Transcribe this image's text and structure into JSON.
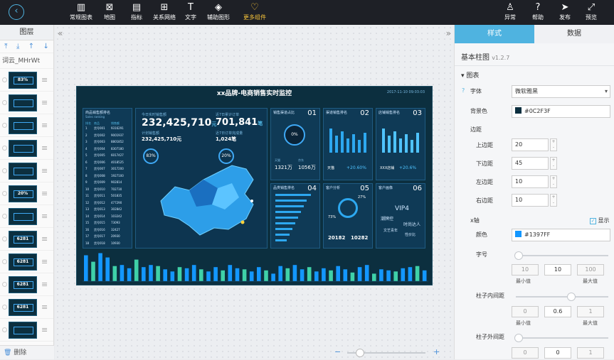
{
  "toolbar": {
    "tools": [
      {
        "label": "常规图表",
        "icon": "chart-icon"
      },
      {
        "label": "地图",
        "icon": "map-icon"
      },
      {
        "label": "指标",
        "icon": "indicator-icon"
      },
      {
        "label": "关系网络",
        "icon": "network-icon"
      },
      {
        "label": "文字",
        "icon": "text-icon"
      },
      {
        "label": "辅助图形",
        "icon": "shape-icon"
      },
      {
        "label": "更多组件",
        "icon": "more-icon"
      }
    ],
    "right": [
      {
        "label": "异常",
        "icon": "alert-icon"
      },
      {
        "label": "帮助",
        "icon": "help-icon"
      },
      {
        "label": "发布",
        "icon": "publish-icon"
      },
      {
        "label": "预览",
        "icon": "preview-icon"
      }
    ]
  },
  "layers": {
    "title": "图层",
    "word_cloud_item": "词云_MHrWt",
    "delete_label": "删除",
    "thumbs": [
      {
        "t": "83%"
      },
      {
        "t": ""
      },
      {
        "t": ""
      },
      {
        "t": ""
      },
      {
        "t": ""
      },
      {
        "t": "20%"
      },
      {
        "t": ""
      },
      {
        "t": "6281"
      },
      {
        "t": "6281"
      },
      {
        "t": "6281"
      },
      {
        "t": "6281"
      },
      {
        "t": ""
      }
    ]
  },
  "screen": {
    "title": "xx品牌-电商销售实时监控",
    "date": "2017-11-10 09:03:03",
    "rank_title": "商品销售额排名",
    "rank_sub": "Sales ranking",
    "rank_headers": [
      "排名",
      "商品",
      "销售额"
    ],
    "rank_rows": [
      [
        "1",
        "货号001",
        "9316291"
      ],
      [
        "2",
        "货号002",
        "9001937"
      ],
      [
        "3",
        "货号003",
        "8801852"
      ],
      [
        "4",
        "货号004",
        "8307180"
      ],
      [
        "5",
        "货号005",
        "6017427"
      ],
      [
        "6",
        "货号006",
        "4018525"
      ],
      [
        "7",
        "货号007",
        "3017200"
      ],
      [
        "8",
        "货号008",
        "1927100"
      ],
      [
        "9",
        "货号009",
        "902814"
      ],
      [
        "10",
        "货号010",
        "702730"
      ],
      [
        "11",
        "货号011",
        "501835"
      ],
      [
        "12",
        "货号012",
        "477290"
      ],
      [
        "13",
        "货号013",
        "302842"
      ],
      [
        "14",
        "货号014",
        "103242"
      ],
      [
        "15",
        "货号015",
        "73093"
      ],
      [
        "16",
        "货号016",
        "32427"
      ],
      [
        "17",
        "货号017",
        "20930"
      ],
      [
        "18",
        "货号018",
        "10930"
      ]
    ],
    "today_label": "今日实时销售额",
    "today_value": "232,425,710",
    "today_unit": "元",
    "plan_label": "计划销售额",
    "plan_value": "232,425,710元",
    "orders_label": "近7日累计订单",
    "orders_value": "701,841",
    "orders_unit": "笔",
    "orders_sub_label": "近7日订单完成量",
    "orders_sub_value": "1,024笔",
    "ring1": "83%",
    "ring2": "20%",
    "cards": [
      {
        "title": "销售渠道占比",
        "num": "01",
        "ring": "0%",
        "a_label": "天猫",
        "a_val": "1321万",
        "b_label": "京东",
        "b_val": "1056万"
      },
      {
        "title": "渠道销售排名",
        "num": "02",
        "foot": "天猫",
        "pct": "+20.60%"
      },
      {
        "title": "店铺销售排名",
        "num": "03",
        "foot": "XXX店铺",
        "pct": "+20.6%"
      },
      {
        "title": "品类销售排名",
        "num": "04"
      },
      {
        "title": "客户分析",
        "num": "05",
        "p1": "27%",
        "p2": "73%",
        "v1": "20182",
        "v2": "10282"
      },
      {
        "title": "客户画像",
        "num": "06",
        "words": [
          "VIP4",
          "潮牌控",
          "时尚达人",
          "文艺青年",
          "性价比"
        ]
      }
    ],
    "bars": [
      48,
      36,
      52,
      44,
      28,
      30,
      24,
      40,
      26,
      30,
      28,
      22,
      18,
      26,
      24,
      30,
      22,
      18,
      26,
      20,
      30,
      24,
      22,
      18,
      26,
      20,
      14,
      28,
      24,
      30,
      22,
      26,
      18,
      24,
      20,
      28,
      22,
      16,
      26,
      30,
      14,
      22,
      20,
      18,
      24,
      26,
      28,
      20
    ]
  },
  "zoom": {
    "minus": "−",
    "plus": "+"
  },
  "props": {
    "tab_style": "样式",
    "tab_data": "数据",
    "component": "基本柱图",
    "version": "v1.2.7",
    "section_chart": "图表",
    "font_label": "字体",
    "font_value": "微软雅黑",
    "bg_label": "背景色",
    "bg_value": "#0C2F3F",
    "margin_label": "边距",
    "top_label": "上边距",
    "top_value": "20",
    "bottom_label": "下边距",
    "bottom_value": "45",
    "left_label": "左边距",
    "left_value": "10",
    "right_label": "右边距",
    "right_value": "10",
    "xaxis_label": "x轴",
    "show_label": "显示",
    "color_label": "颜色",
    "color_value": "#1397FF",
    "fontsize_label": "字号",
    "fs_min": "10",
    "fs_val": "10",
    "fs_max": "100",
    "min_cap": "最小值",
    "max_cap": "最大值",
    "inner_label": "柱子内间距",
    "in_min": "0",
    "in_val": "0.6",
    "in_max": "1",
    "outer_label": "柱子外间距",
    "out_min": "0",
    "out_val": "0",
    "out_max": "1"
  },
  "colors": {
    "accent": "#4fb3e0",
    "screen_bg": "#0C2F3F",
    "bar": "#1397FF"
  }
}
